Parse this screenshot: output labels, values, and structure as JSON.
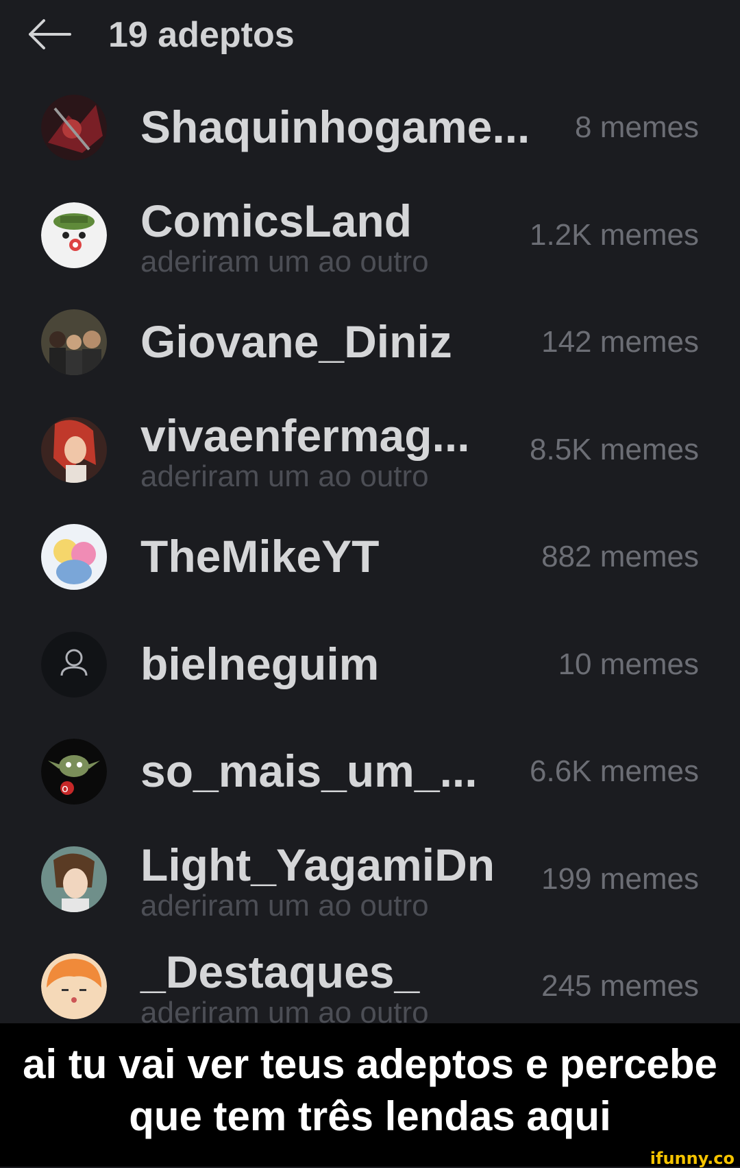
{
  "header": {
    "title": "19 adeptos",
    "back_icon": "arrow-left-icon"
  },
  "followers": [
    {
      "name": "Shaquinhogame...",
      "subtitle": "",
      "count": "8 memes",
      "avatar": "dark-red-warrior",
      "avatar_bg": "#3a1a1e"
    },
    {
      "name": "ComicsLand",
      "subtitle": "aderiram um ao outro",
      "count": "1.2K memes",
      "avatar": "white-cartoon-hat",
      "avatar_bg": "#f2f2f2"
    },
    {
      "name": "Giovane_Diniz",
      "subtitle": "",
      "count": "142 memes",
      "avatar": "group-photo",
      "avatar_bg": "#4a4638"
    },
    {
      "name": "vivaenfermag...",
      "subtitle": "aderiram um ao outro",
      "count": "8.5K memes",
      "avatar": "red-hair-character",
      "avatar_bg": "#5a2a24"
    },
    {
      "name": "TheMikeYT",
      "subtitle": "",
      "count": "882 memes",
      "avatar": "anime-hug",
      "avatar_bg": "#e8eef5"
    },
    {
      "name": "bielneguim",
      "subtitle": "",
      "count": "10 memes",
      "avatar": "default-user-icon",
      "avatar_bg": "#111316"
    },
    {
      "name": "so_mais_um_...",
      "subtitle": "",
      "count": "6.6K memes",
      "avatar": "yoda-black",
      "avatar_bg": "#0a0a0a"
    },
    {
      "name": "Light_YagamiDn",
      "subtitle": "aderiram um ao outro",
      "count": "199 memes",
      "avatar": "anime-boy",
      "avatar_bg": "#6f8f8a"
    },
    {
      "name": "_Destaques_",
      "subtitle": "aderiram um ao outro",
      "count": "245 memes",
      "avatar": "orange-cartoon",
      "avatar_bg": "#f08a3a"
    }
  ],
  "caption": {
    "line1": "ai tu vai ver teus adeptos e percebe",
    "line2": "que tem três lendas aqui"
  },
  "watermark": "ifunny.co"
}
